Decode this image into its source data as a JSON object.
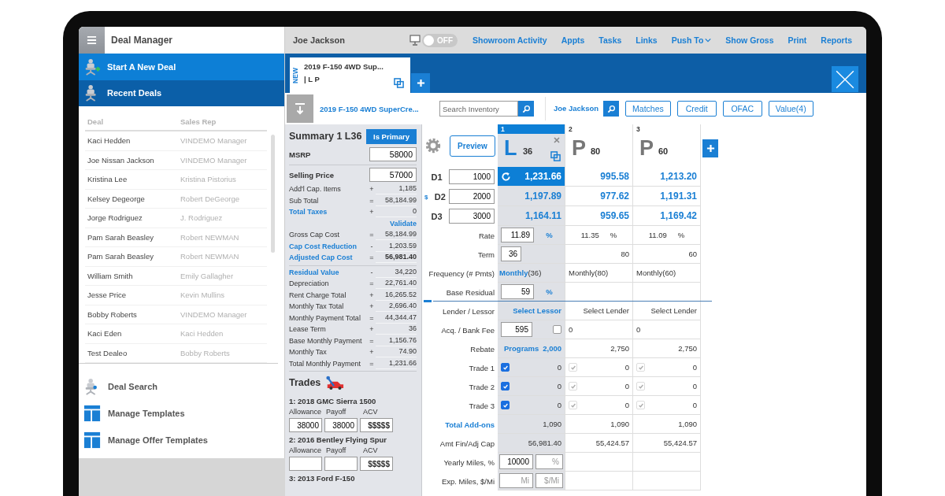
{
  "sidebar": {
    "title": "Deal Manager",
    "nav": [
      {
        "label": "Start A New Deal",
        "kind": "new"
      },
      {
        "label": "Recent Deals",
        "kind": "recent"
      }
    ],
    "deals": {
      "columns": [
        "Deal",
        "Sales Rep"
      ],
      "rows": [
        {
          "deal": "Kaci Hedden",
          "rep": "VINDEMO Manager"
        },
        {
          "deal": "Joe Nissan Jackson",
          "rep": "VINDEMO Manager"
        },
        {
          "deal": "Kristina Lee",
          "rep": "Kristina Pistorius"
        },
        {
          "deal": "Kelsey Degeorge",
          "rep": "Robert DeGeorge"
        },
        {
          "deal": "Jorge Rodriguez",
          "rep": "J. Rodriguez"
        },
        {
          "deal": "Pam Sarah Beasley",
          "rep": "Robert NEWMAN"
        },
        {
          "deal": "Pam Sarah Beasley",
          "rep": "Robert NEWMAN"
        },
        {
          "deal": "William Smith",
          "rep": "Emily Gallagher"
        },
        {
          "deal": "Jesse Price",
          "rep": "Kevin Mullins"
        },
        {
          "deal": "Bobby Roberts",
          "rep": "VINDEMO Manager"
        },
        {
          "deal": "Kaci Eden",
          "rep": "Kaci Hedden"
        },
        {
          "deal": "Test Dealeo",
          "rep": "Bobby Roberts"
        }
      ]
    },
    "links": [
      {
        "label": "Deal Search",
        "kind": "search"
      },
      {
        "label": "Manage Templates",
        "kind": "template"
      },
      {
        "label": "Manage Offer Templates",
        "kind": "template"
      }
    ]
  },
  "topbar": {
    "customer": "Joe Jackson",
    "toggle": {
      "label": "OFF",
      "on": false
    },
    "links": [
      {
        "label": "Showroom Activity",
        "dropdown": false
      },
      {
        "label": "Appts",
        "dropdown": false
      },
      {
        "label": "Tasks",
        "dropdown": false
      },
      {
        "label": "Links",
        "dropdown": false
      },
      {
        "label": "Push To",
        "dropdown": true
      },
      {
        "label": "Show Gross",
        "dropdown": false
      },
      {
        "label": "Print",
        "dropdown": false
      },
      {
        "label": "Reports",
        "dropdown": false
      }
    ]
  },
  "tabs": [
    {
      "badge": "NEW",
      "title": "2019 F-150 4WD Sup...",
      "subtitle": "| L P",
      "selected": true
    }
  ],
  "toolbar": {
    "vehicle": "2019 F-150 4WD SuperCre...",
    "search": {
      "placeholder": "Search Inventory"
    },
    "customer": "Joe Jackson",
    "buttons": [
      "Matches",
      "Credit",
      "OFAC",
      "Value(4)"
    ]
  },
  "summary": {
    "title": "Summary 1 L36",
    "primary_button": "Is Primary",
    "sections": [
      [
        {
          "kind": "input",
          "label": "MSRP",
          "value": "58000"
        }
      ],
      [
        {
          "kind": "input",
          "label": "Selling Price",
          "value": "57000"
        },
        {
          "kind": "calc",
          "label": "Add'l Cap. Items",
          "op": "+",
          "value": "1,185",
          "link": false,
          "bold": false
        },
        {
          "kind": "calc",
          "label": "Sub Total",
          "op": "=",
          "value": "58,184.99",
          "link": false,
          "bold": false
        },
        {
          "kind": "calc",
          "label": "Total Taxes",
          "op": "+",
          "value": "0",
          "link": true,
          "bold": false
        },
        {
          "kind": "action",
          "label": "Validate"
        },
        {
          "kind": "calc",
          "label": "Gross Cap Cost",
          "op": "=",
          "value": "58,184.99",
          "link": false,
          "bold": false
        },
        {
          "kind": "calc",
          "label": "Cap Cost Reduction",
          "op": "-",
          "value": "1,203.59",
          "link": true,
          "bold": false
        },
        {
          "kind": "calc",
          "label": "Adjusted Cap Cost",
          "op": "=",
          "value": "56,981.40",
          "link": true,
          "bold": true
        }
      ],
      [
        {
          "kind": "calc",
          "label": "Residual Value",
          "op": "-",
          "value": "34,220",
          "link": true,
          "bold": false
        },
        {
          "kind": "calc",
          "label": "Depreciation",
          "op": "=",
          "value": "22,761.40",
          "link": false,
          "bold": false
        },
        {
          "kind": "calc",
          "label": "Rent Charge Total",
          "op": "+",
          "value": "16,265.52",
          "link": false,
          "bold": false
        },
        {
          "kind": "calc",
          "label": "Monthly Tax Total",
          "op": "+",
          "value": "2,696.40",
          "link": false,
          "bold": false
        },
        {
          "kind": "calc",
          "label": "Monthly Payment Total",
          "op": "=",
          "value": "44,344.47",
          "link": false,
          "bold": false
        },
        {
          "kind": "calc",
          "label": "Lease Term",
          "op": "+",
          "value": "36",
          "link": false,
          "bold": false
        },
        {
          "kind": "calc",
          "label": "Base Monthly Payment",
          "op": "=",
          "value": "1,156.76",
          "link": false,
          "bold": false
        },
        {
          "kind": "calc",
          "label": "Monthly Tax",
          "op": "+",
          "value": "74.90",
          "link": false,
          "bold": false
        },
        {
          "kind": "calc",
          "label": "Total Monthly Payment",
          "op": "=",
          "value": "1,231.66",
          "link": false,
          "bold": false
        }
      ]
    ],
    "trades_title": "Trades",
    "trades": [
      {
        "title": "1: 2018 GMC Sierra 1500",
        "labels": [
          "Allowance",
          "Payoff",
          "ACV"
        ],
        "allowance": "38000",
        "payoff": "38000",
        "acv_placeholder": "$$$$$"
      },
      {
        "title": "2: 2016 Bentley Flying Spur",
        "labels": [
          "Allowance",
          "Payoff",
          "ACV"
        ],
        "acv_placeholder": "$$$$$"
      },
      {
        "title": "3: 2013 Ford F-150"
      }
    ]
  },
  "grid": {
    "preview_button": "Preview",
    "columns": [
      {
        "number": "1",
        "letter": "L",
        "term": "36",
        "selected": true
      },
      {
        "number": "2",
        "letter": "P",
        "term": "80",
        "selected": false
      },
      {
        "number": "3",
        "letter": "P",
        "term": "60",
        "selected": false
      }
    ],
    "payments": [
      {
        "label": "D1",
        "value": "1000",
        "cells": [
          {
            "text": "1,231.66",
            "selected": true
          },
          {
            "text": "995.58",
            "selected": false
          },
          {
            "text": "1,213.20",
            "selected": false
          }
        ]
      },
      {
        "label": "D2",
        "prefix": "$",
        "value": "2000",
        "cells": [
          {
            "text": "1,197.89",
            "selected": false
          },
          {
            "text": "977.62",
            "selected": false
          },
          {
            "text": "1,191.31",
            "selected": false
          }
        ]
      },
      {
        "label": "D3",
        "value": "3000",
        "cells": [
          {
            "text": "1,164.11",
            "selected": false
          },
          {
            "text": "959.65",
            "selected": false
          },
          {
            "text": "1,169.42",
            "selected": false
          }
        ]
      }
    ],
    "term_rows": [
      {
        "label": "Rate",
        "label_link": false,
        "cells": [
          {
            "kind": "input",
            "value": "11.89",
            "unit": "%"
          },
          {
            "kind": "text",
            "text": "11.35",
            "unit": "%"
          },
          {
            "kind": "text",
            "text": "11.09",
            "unit": "%"
          }
        ]
      },
      {
        "label": "Term",
        "label_link": false,
        "cells": [
          {
            "kind": "input",
            "value": "36"
          },
          {
            "kind": "text",
            "text": "80"
          },
          {
            "kind": "text",
            "text": "60"
          }
        ]
      },
      {
        "label": "Frequency (# Pmts)",
        "label_link": false,
        "cells": [
          {
            "kind": "frequency",
            "link": "Monthly",
            "text": "(36)"
          },
          {
            "kind": "note",
            "text": "Monthly(80)"
          },
          {
            "kind": "note",
            "text": "Monthly(60)"
          }
        ]
      },
      {
        "label": "Base Residual",
        "label_link": false,
        "cells": [
          {
            "kind": "input",
            "value": "59",
            "unit": "%"
          },
          {
            "kind": "empty"
          },
          {
            "kind": "empty"
          }
        ]
      }
    ],
    "detail_rows": [
      {
        "label": "Lender / Lessor",
        "label_link": false,
        "cells": [
          {
            "kind": "link",
            "text": "Select Lessor"
          },
          {
            "kind": "text",
            "text": "Select Lender"
          },
          {
            "kind": "text",
            "text": "Select Lender"
          }
        ]
      },
      {
        "label": "Acq. / Bank Fee",
        "label_link": false,
        "cells": [
          {
            "kind": "input_check",
            "value": "595",
            "checked": false
          },
          {
            "kind": "note",
            "text": "0"
          },
          {
            "kind": "note",
            "text": "0"
          }
        ]
      },
      {
        "label": "Rebate",
        "label_link": false,
        "cells": [
          {
            "kind": "programs",
            "link": "Programs",
            "text": "2,000"
          },
          {
            "kind": "text",
            "text": "2,750"
          },
          {
            "kind": "text",
            "text": "2,750"
          }
        ]
      },
      {
        "label": "Trade 1",
        "label_link": false,
        "cells": [
          {
            "kind": "check",
            "checked": true,
            "disabled": false,
            "text": "0"
          },
          {
            "kind": "check",
            "checked": true,
            "disabled": true,
            "text": "0"
          },
          {
            "kind": "check",
            "checked": true,
            "disabled": true,
            "text": "0"
          }
        ]
      },
      {
        "label": "Trade 2",
        "label_link": false,
        "cells": [
          {
            "kind": "check",
            "checked": true,
            "disabled": false,
            "text": "0"
          },
          {
            "kind": "check",
            "checked": true,
            "disabled": true,
            "text": "0"
          },
          {
            "kind": "check",
            "checked": true,
            "disabled": true,
            "text": "0"
          }
        ]
      },
      {
        "label": "Trade 3",
        "label_link": false,
        "cells": [
          {
            "kind": "check",
            "checked": true,
            "disabled": false,
            "text": "0"
          },
          {
            "kind": "check",
            "checked": true,
            "disabled": true,
            "text": "0"
          },
          {
            "kind": "check",
            "checked": true,
            "disabled": true,
            "text": "0"
          }
        ]
      },
      {
        "label": "Total Add-ons",
        "label_link": true,
        "cells": [
          {
            "kind": "text",
            "text": "1,090"
          },
          {
            "kind": "text",
            "text": "1,090"
          },
          {
            "kind": "text",
            "text": "1,090"
          }
        ]
      },
      {
        "label": "Amt Fin/Adj Cap",
        "label_link": false,
        "cells": [
          {
            "kind": "text",
            "text": "56,981.40"
          },
          {
            "kind": "text",
            "text": "55,424.57"
          },
          {
            "kind": "text",
            "text": "55,424.57"
          }
        ]
      },
      {
        "label": "Yearly Miles, %",
        "label_link": false,
        "cells": [
          {
            "kind": "pair",
            "first": {
              "value": "10000"
            },
            "second": {
              "placeholder": "%"
            }
          },
          {
            "kind": "empty"
          },
          {
            "kind": "empty"
          }
        ]
      },
      {
        "label": "Exp. Miles, $/Mi",
        "label_link": false,
        "cells": [
          {
            "kind": "pair",
            "first": {
              "placeholder": "Mi"
            },
            "second": {
              "placeholder": "$/Mi"
            }
          },
          {
            "kind": "empty"
          },
          {
            "kind": "empty"
          }
        ]
      }
    ]
  }
}
